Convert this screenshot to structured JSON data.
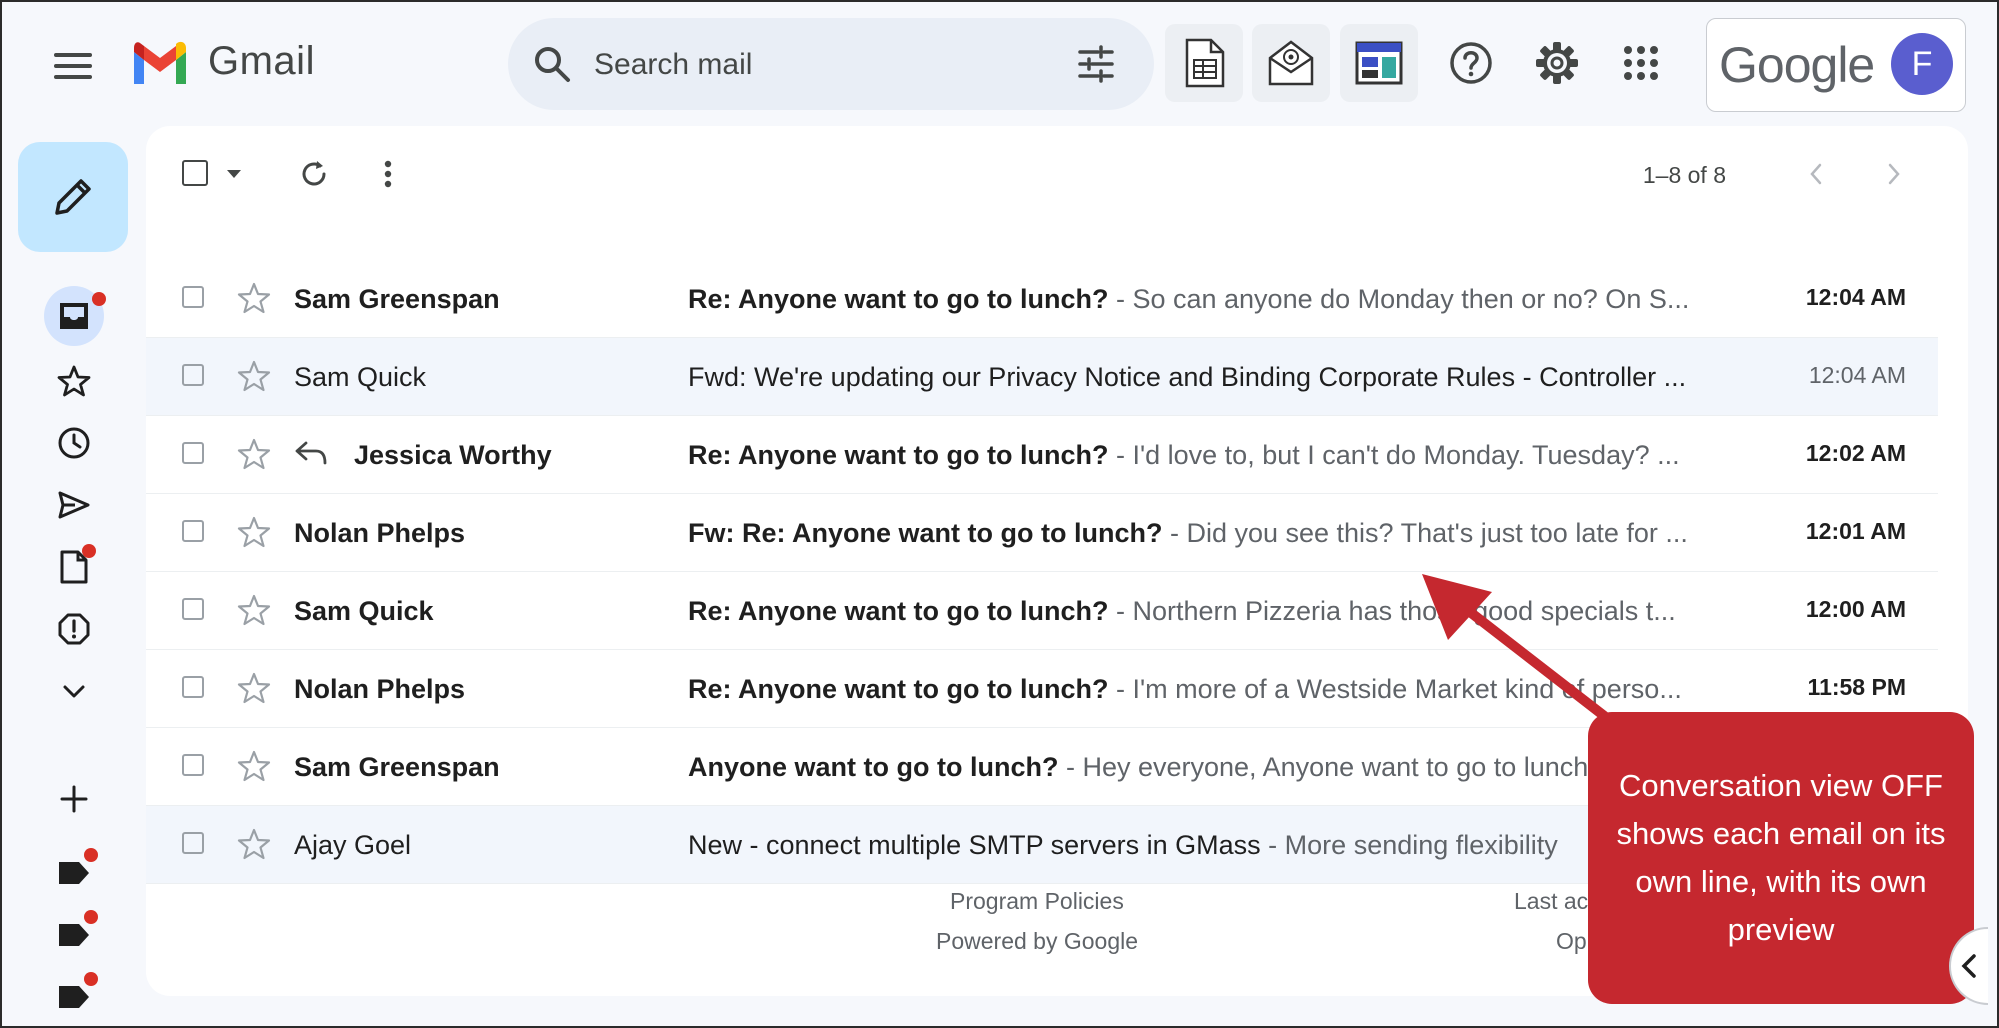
{
  "header": {
    "app_name": "Gmail",
    "search_placeholder": "Search mail",
    "google_word": "Google",
    "avatar_initial": "F"
  },
  "toolbar": {
    "pager_text": "1–8 of 8"
  },
  "emails": [
    {
      "sender": "Sam Greenspan",
      "subject": "Re: Anyone want to go to lunch?",
      "snippet": "So can anyone do Monday then or no? On S...",
      "time": "12:04 AM",
      "unread": true,
      "replied": false
    },
    {
      "sender": "Sam Quick",
      "subject": "Fwd: We're updating our Privacy Notice and Binding Corporate Rules - Controller ...",
      "snippet": "",
      "time": "12:04 AM",
      "unread": false,
      "replied": false
    },
    {
      "sender": "Jessica Worthy",
      "subject": "Re: Anyone want to go to lunch?",
      "snippet": "I'd love to, but I can't do Monday. Tuesday? ...",
      "time": "12:02 AM",
      "unread": true,
      "replied": true
    },
    {
      "sender": "Nolan Phelps",
      "subject": "Fw: Re: Anyone want to go to lunch?",
      "snippet": "Did you see this? That's just too late for ...",
      "time": "12:01 AM",
      "unread": true,
      "replied": false
    },
    {
      "sender": "Sam Quick",
      "subject": "Re: Anyone want to go to lunch?",
      "snippet": "Northern Pizzeria has those good specials t...",
      "time": "12:00 AM",
      "unread": true,
      "replied": false
    },
    {
      "sender": "Nolan Phelps",
      "subject": "Re: Anyone want to go to lunch?",
      "snippet": "I'm more of a Westside Market kind of perso...",
      "time": "11:58 PM",
      "unread": true,
      "replied": false
    },
    {
      "sender": "Sam Greenspan",
      "subject": "Anyone want to go to lunch?",
      "snippet": "Hey everyone, Anyone want to go to lunch",
      "time": "",
      "unread": true,
      "replied": false
    },
    {
      "sender": "Ajay Goel",
      "subject": "New - connect multiple SMTP servers in GMass",
      "snippet": "More sending flexibility",
      "time": "",
      "unread": false,
      "replied": false
    }
  ],
  "footer": {
    "program_policies": "Program Policies",
    "powered_by": "Powered by Google",
    "last_activity_partial": "Last ac",
    "open_partial": "Op"
  },
  "callout": {
    "text": "Conversation view OFF shows each email on its own line, with its own preview"
  },
  "colors": {
    "callout_bg": "#c5282f",
    "compose_bg": "#c2e7ff",
    "read_row_bg": "#f2f6fc",
    "avatar_bg": "#5a5ecf",
    "notification_dot": "#d93025"
  }
}
